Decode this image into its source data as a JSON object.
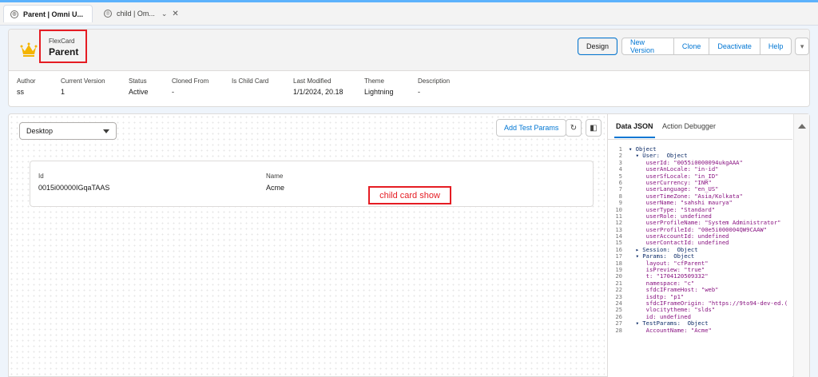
{
  "browser_tabs": [
    {
      "label": "Parent | Omni U...",
      "active": true
    },
    {
      "label": "child | Om...",
      "active": false
    }
  ],
  "header": {
    "eyebrow": "FlexCard",
    "title": "Parent",
    "buttons": {
      "design": "Design",
      "new_version": "New Version",
      "clone": "Clone",
      "deactivate": "Deactivate",
      "help": "Help",
      "more": "▾"
    },
    "meta": [
      {
        "label": "Author",
        "value": "ss"
      },
      {
        "label": "Current Version",
        "value": "1"
      },
      {
        "label": "Status",
        "value": "Active"
      },
      {
        "label": "Cloned From",
        "value": "-"
      },
      {
        "label": "Is Child Card",
        "value": ""
      },
      {
        "label": "Last Modified",
        "value": "1/1/2024, 20.18"
      },
      {
        "label": "Theme",
        "value": "Lightning"
      },
      {
        "label": "Description",
        "value": "-"
      }
    ]
  },
  "canvas": {
    "device": "Desktop",
    "add_test_params": "Add Test Params",
    "refresh_icon": "refresh-icon",
    "panel_icon": "panel-toggle-icon",
    "card": {
      "id_label": "Id",
      "id_value": "0015i00000IGqaTAAS",
      "name_label": "Name",
      "name_value": "Acme"
    },
    "annotation": "child card show"
  },
  "panel": {
    "tabs": [
      "Data JSON",
      "Action Debugger"
    ],
    "json_lines": [
      {
        "n": "1",
        "t": "▾ Object"
      },
      {
        "n": "2",
        "t": "  ▾ User:  Object"
      },
      {
        "n": "3",
        "t": "     userId: \"0055i0000094ukgAAA\""
      },
      {
        "n": "4",
        "t": "     userAnLocale: \"in-id\""
      },
      {
        "n": "5",
        "t": "     userSfLocale: \"in_ID\""
      },
      {
        "n": "6",
        "t": "     userCurrency: \"INR\""
      },
      {
        "n": "7",
        "t": "     userLanguage: \"en_US\""
      },
      {
        "n": "8",
        "t": "     userTimeZone: \"Asia/Kolkata\""
      },
      {
        "n": "9",
        "t": "     userName: \"sahshi maurya\""
      },
      {
        "n": "10",
        "t": "     userType: \"Standard\""
      },
      {
        "n": "11",
        "t": "     userRole: undefined"
      },
      {
        "n": "12",
        "t": "     userProfileName: \"System Administrator\""
      },
      {
        "n": "13",
        "t": "     userProfileId: \"00e5i000004QW9CAAW\""
      },
      {
        "n": "14",
        "t": "     userAccountId: undefined"
      },
      {
        "n": "15",
        "t": "     userContactId: undefined"
      },
      {
        "n": "16",
        "t": "  ▸ Session:  Object"
      },
      {
        "n": "17",
        "t": "  ▾ Params:  Object"
      },
      {
        "n": "18",
        "t": "     layout: \"cfParent\""
      },
      {
        "n": "19",
        "t": "     isPreview: \"true\""
      },
      {
        "n": "20",
        "t": "     t: \"1704120509332\""
      },
      {
        "n": "21",
        "t": "     namespace: \"c\""
      },
      {
        "n": "22",
        "t": "     sfdcIFrameHost: \"web\""
      },
      {
        "n": "23",
        "t": "     isdtp: \"p1\""
      },
      {
        "n": "24",
        "t": "     sfdcIFrameOrigin: \"https://9to94-dev-ed.("
      },
      {
        "n": "25",
        "t": "     vlocitytheme: \"slds\""
      },
      {
        "n": "26",
        "t": "     id: undefined"
      },
      {
        "n": "27",
        "t": "  ▾ TestParams:  Object"
      },
      {
        "n": "28",
        "t": "     AccountName: \"Acme\""
      }
    ]
  },
  "colors": {
    "brand_blue": "#0176d3",
    "annotation_red": "#e51c23",
    "crown_gold": "#f4b400"
  }
}
